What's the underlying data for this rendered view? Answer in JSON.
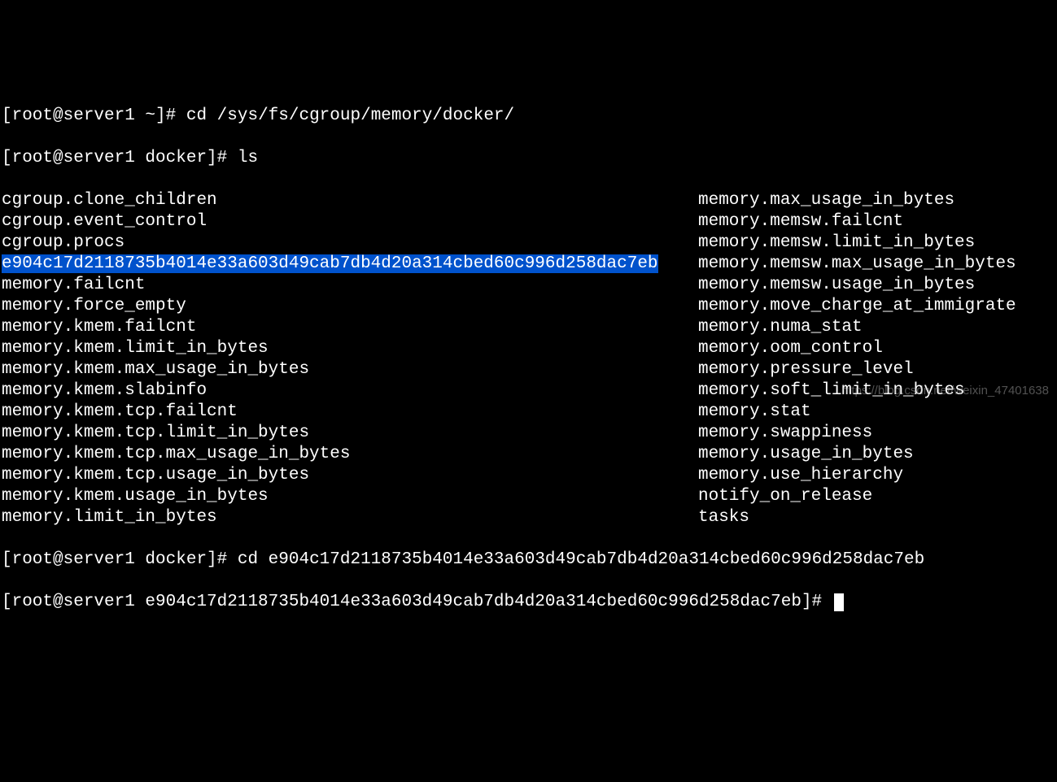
{
  "prompt1": {
    "user_host": "[root@server1 ~]#",
    "command": "cd /sys/fs/cgroup/memory/docker/"
  },
  "prompt2": {
    "user_host": "[root@server1 docker]#",
    "command": "ls"
  },
  "listing": {
    "left": [
      "cgroup.clone_children",
      "cgroup.event_control",
      "cgroup.procs",
      "e904c17d2118735b4014e33a603d49cab7db4d20a314cbed60c996d258dac7eb",
      "memory.failcnt",
      "memory.force_empty",
      "memory.kmem.failcnt",
      "memory.kmem.limit_in_bytes",
      "memory.kmem.max_usage_in_bytes",
      "memory.kmem.slabinfo",
      "memory.kmem.tcp.failcnt",
      "memory.kmem.tcp.limit_in_bytes",
      "memory.kmem.tcp.max_usage_in_bytes",
      "memory.kmem.tcp.usage_in_bytes",
      "memory.kmem.usage_in_bytes",
      "memory.limit_in_bytes"
    ],
    "right": [
      "memory.max_usage_in_bytes",
      "memory.memsw.failcnt",
      "memory.memsw.limit_in_bytes",
      "memory.memsw.max_usage_in_bytes",
      "memory.memsw.usage_in_bytes",
      "memory.move_charge_at_immigrate",
      "memory.numa_stat",
      "memory.oom_control",
      "memory.pressure_level",
      "memory.soft_limit_in_bytes",
      "memory.stat",
      "memory.swappiness",
      "memory.usage_in_bytes",
      "memory.use_hierarchy",
      "notify_on_release",
      "tasks"
    ],
    "highlighted_index": 3
  },
  "prompt3": {
    "user_host": "[root@server1 docker]#",
    "command": "cd e904c17d2118735b4014e33a603d49cab7db4d20a314cbed60c996d258dac7eb"
  },
  "prompt4": {
    "user_host": "[root@server1 e904c17d2118735b4014e33a603d49cab7db4d20a314cbed60c996d258dac7eb]#",
    "command": ""
  },
  "watermark": "https://blog.csdn.net/weixin_47401638"
}
